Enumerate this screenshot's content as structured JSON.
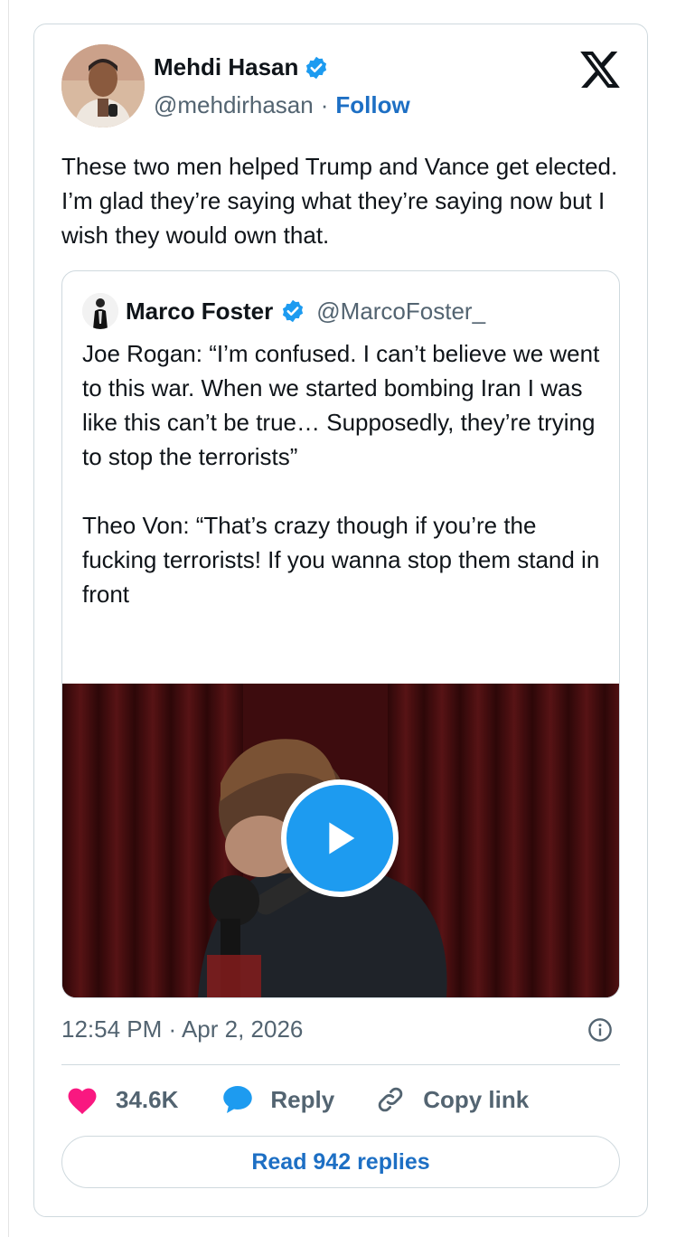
{
  "tweet": {
    "author_name": "Mehdi Hasan",
    "author_handle": "@mehdirhasan",
    "separator": "·",
    "follow_label": "Follow",
    "text": "These two men helped Trump and Vance get elected. I’m glad they’re saying what they’re saying now but I wish they would own that.",
    "timestamp": "12:54 PM · Apr 2, 2026"
  },
  "quote": {
    "author_name": "Marco Foster",
    "author_handle": "@MarcoFoster_",
    "text": "Joe Rogan: “I’m confused. I can’t believe we went to this war. When we started bombing Iran I was like this can’t be true… Supposedly, they’re trying to stop the terrorists”\n\nTheo Von: “That’s crazy though if you’re the fucking terrorists! If you wanna stop them stand in front"
  },
  "actions": {
    "likes": "34.6K",
    "reply_label": "Reply",
    "copy_label": "Copy link",
    "read_replies_label": "Read 942 replies"
  },
  "icons": [
    "verified-icon",
    "x-logo-icon",
    "play-icon",
    "info-icon",
    "heart-icon",
    "reply-bubble-icon",
    "link-icon"
  ],
  "colors": {
    "accent": "#1d9bf0",
    "link": "#1d6fc4",
    "like": "#f91880",
    "muted": "#536471",
    "border": "#cfd9de"
  }
}
